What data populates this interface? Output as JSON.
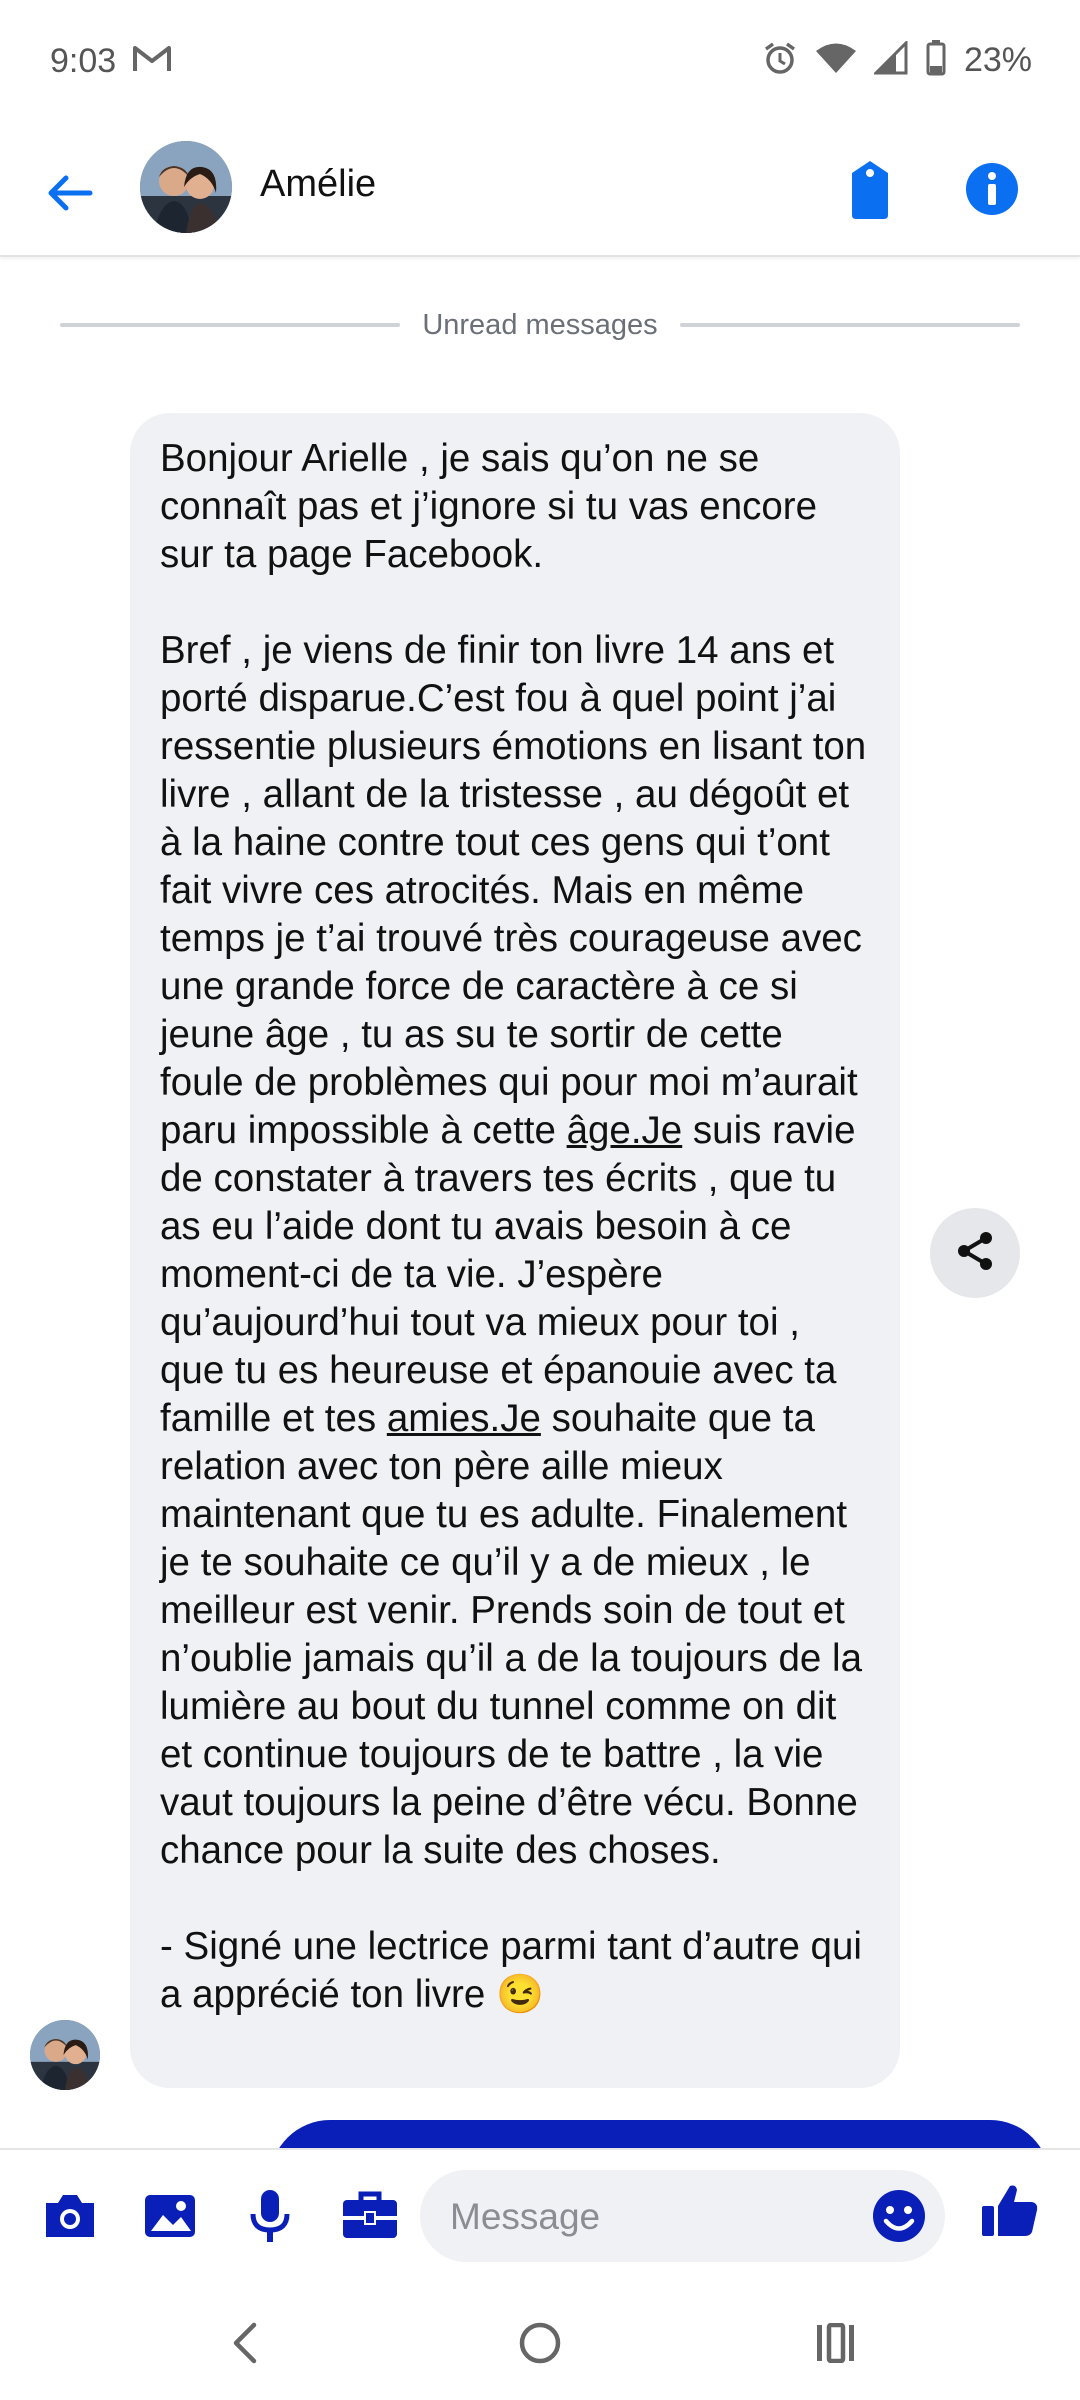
{
  "status_bar": {
    "time": "9:03",
    "battery": "23%"
  },
  "header": {
    "contact_name": "Amélie"
  },
  "divider": {
    "label": "Unread messages"
  },
  "message": {
    "p1": "Bonjour Arielle , je sais qu’on ne se connaît pas et j’ignore si tu vas encore sur ta page Facebook.",
    "p2_a": "Bref , je viens de finir ton livre 14 ans et porté disparue.C’est fou à quel point j’ai ressentie plusieurs émotions en lisant ton livre , allant de la tristesse , au dégoût et à la haine contre tout ces gens qui t’ont fait vivre ces atrocités. Mais en même temps je t’ai trouvé très courageuse avec une grande force de caractère à ce si jeune âge , tu as su te sortir de cette foule de problèmes qui pour moi m’aurait paru impossible à cette ",
    "p2_link1": "âge.Je",
    "p2_b": " suis ravie de constater à travers tes écrits , que tu as eu l’aide dont tu avais besoin à ce moment-ci de ta vie. J’espère qu’aujourd’hui tout va mieux pour toi , que tu es heureuse et épanouie avec ta famille et tes ",
    "p2_link2": "amies.Je",
    "p2_c": " souhaite que ta relation avec ton père aille mieux maintenant que tu es adulte. Finalement je te souhaite ce qu’il y a de mieux , le meilleur est venir. Prends soin de tout et n’oublie jamais qu’il a de la toujours de la lumière au bout du tunnel comme on dit et continue toujours de te battre , la vie vaut toujours la peine d’être vécu. Bonne chance pour la suite des choses.",
    "p3": "- Signé une lectrice parmi tant d’autre qui a apprécié ton livre 😉"
  },
  "composer": {
    "placeholder": "Message"
  },
  "colors": {
    "accent": "#0b6ff2",
    "accent_dark": "#0a1fb7",
    "bubble_bg": "#f0f1f5"
  }
}
